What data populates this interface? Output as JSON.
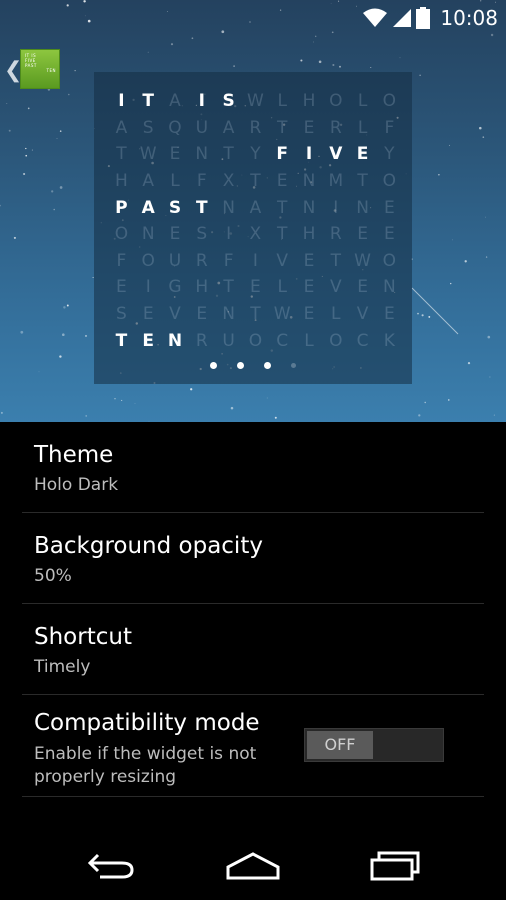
{
  "status_bar": {
    "time": "10:08",
    "icons": [
      "wifi-icon",
      "signal-icon",
      "battery-icon"
    ]
  },
  "widget_preview": {
    "app_icon_text": [
      "IT IS",
      "FIVE",
      "PAST",
      "TEN"
    ],
    "grid_rows": [
      "ITAISWLHOLO",
      "ASQUARTERLF",
      "TWENTYFIVEY",
      "HALFXTENMTO",
      "PASTNATNINE",
      "ONESIXTHREE",
      "FOURFIVETWO",
      "EIGHTELEVEN",
      "SEVENTWELVE",
      "TENRUOCLOCK"
    ],
    "lit": [
      [
        0,
        0
      ],
      [
        0,
        1
      ],
      [
        0,
        3
      ],
      [
        0,
        4
      ],
      [
        2,
        6
      ],
      [
        2,
        7
      ],
      [
        2,
        8
      ],
      [
        2,
        9
      ],
      [
        4,
        0
      ],
      [
        4,
        1
      ],
      [
        4,
        2
      ],
      [
        4,
        3
      ],
      [
        9,
        0
      ],
      [
        9,
        1
      ],
      [
        9,
        2
      ]
    ],
    "page_indicator": {
      "pages": 4,
      "active_dots": 3
    }
  },
  "settings": {
    "theme": {
      "title": "Theme",
      "value": "Holo Dark"
    },
    "opacity": {
      "title": "Background opacity",
      "value": "50%"
    },
    "shortcut": {
      "title": "Shortcut",
      "value": "Timely"
    },
    "compat": {
      "title": "Compatibility mode",
      "description": "Enable if the widget is not properly resizing",
      "toggle": "OFF"
    }
  },
  "nav_bar": [
    "back-icon",
    "home-icon",
    "recents-icon"
  ]
}
